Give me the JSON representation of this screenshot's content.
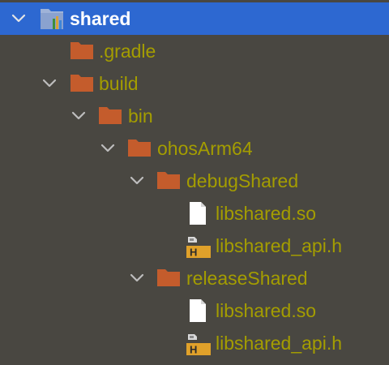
{
  "project_tree": {
    "colors": {
      "panel_background": "#494741",
      "selection": "#2d68d1",
      "excluded_text": "#a49d00",
      "folder": "#c45c2c",
      "header_badge": "#e0a12a"
    },
    "nodes": [
      {
        "label": "shared",
        "icon": "module-icon",
        "expanded": true,
        "selected": true
      },
      {
        "label": ".gradle",
        "icon": "folder-icon",
        "expanded": false,
        "selected": false
      },
      {
        "label": "build",
        "icon": "folder-icon",
        "expanded": true,
        "selected": false
      },
      {
        "label": "bin",
        "icon": "folder-icon",
        "expanded": true,
        "selected": false
      },
      {
        "label": "ohosArm64",
        "icon": "folder-icon",
        "expanded": true,
        "selected": false
      },
      {
        "label": "debugShared",
        "icon": "folder-icon",
        "expanded": true,
        "selected": false
      },
      {
        "label": "libshared.so",
        "icon": "file-icon",
        "selected": false
      },
      {
        "label": "libshared_api.h",
        "icon": "header-file-icon",
        "badge": "H",
        "selected": false
      },
      {
        "label": "releaseShared",
        "icon": "folder-icon",
        "expanded": true,
        "selected": false
      },
      {
        "label": "libshared.so",
        "icon": "file-icon",
        "selected": false
      },
      {
        "label": "libshared_api.h",
        "icon": "header-file-icon",
        "badge": "H",
        "selected": false
      }
    ]
  }
}
